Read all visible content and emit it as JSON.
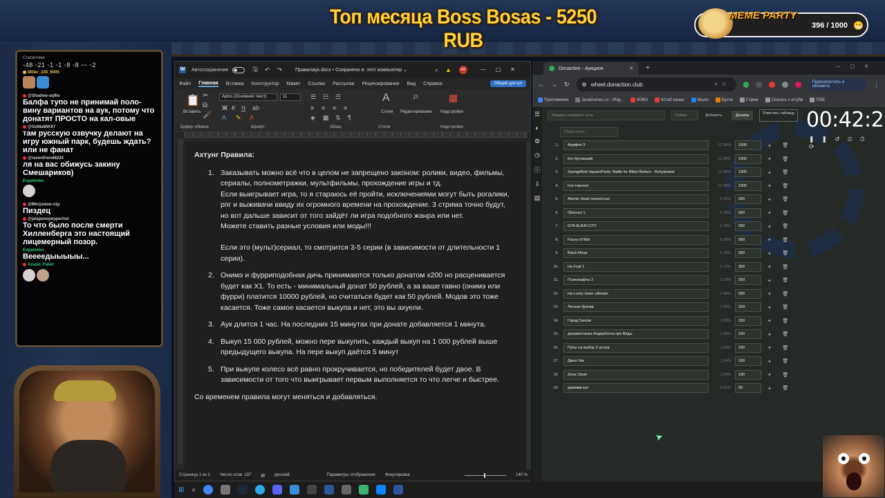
{
  "overlay": {
    "title": "Топ месяца Boss Bosas - 5250 RUB",
    "meme_party": {
      "title": "MEME PARTY",
      "counter": "396 / 1000"
    }
  },
  "chat": {
    "stats_title": "Статистика",
    "stats_line": "◦48 ◦21 ◦1 ◦1 ◦8 ◦8 ◦~ ◦2",
    "messages": [
      {
        "user": "Miller_228_6005",
        "text": "",
        "color": "#e6c14a"
      },
      {
        "user": "@Shadow-sq9lo",
        "text": "Балфа тупо не принимай поло-вину вариантов на аук, потому что донатят ПРОСТО на кал-овые",
        "color": "#cfcfcf"
      },
      {
        "user": "@GoMaMiK67",
        "text": "там русскую озвучку делают на игру южный парк, будешь ждать? или не фанат",
        "color": "#cfcfcf"
      },
      {
        "user": "@ravenfriend8224",
        "text": "ля на вас обижусь закину Смешариков)",
        "color": "#cfcfcf"
      },
      {
        "user": "Evpatenko",
        "text": "",
        "color": "#2ecc71"
      },
      {
        "user": "@Метрокон-з1р",
        "text": "Пиздец",
        "color": "#cfcfcf"
      },
      {
        "user": "@jalapenopepperhot",
        "text": "То что было после смерти Хилленберга это настоящий лицемерный позор.",
        "color": "#cfcfcf"
      },
      {
        "user": "Evpatenko",
        "text": "Веееедыыыыы...",
        "color": "#2ecc71"
      },
      {
        "user": "Azazel_Falen",
        "text": "",
        "color": "#2ecc71"
      }
    ]
  },
  "word": {
    "autosave_label": "Автосохранение",
    "doc_title": "Правилаук.docx • Сохранено в: этот компьютер ⌄",
    "user_initials": "AS",
    "menu": [
      "Файл",
      "Главная",
      "Вставка",
      "Конструктор",
      "Макет",
      "Ссылки",
      "Рассылки",
      "Рецензирование",
      "Вид",
      "Справка"
    ],
    "active_menu": "Главная",
    "share_label": "Общий доступ",
    "ribbon": {
      "paste_label": "Вставить",
      "font_name": "Aptos (Основной текст)",
      "font_size": "11",
      "styles_label": "Стили",
      "editing_label": "Редактирование",
      "addins_label": "Надстройки",
      "group_clipboard": "Буфер обмена",
      "group_font": "Шрифт",
      "group_paragraph": "Абзац",
      "group_styles": "Стили",
      "group_addins": "Надстройки"
    },
    "document": {
      "heading": "Ахтунг Правила:",
      "items": [
        {
          "num": "1.",
          "text": "Заказывать можно всё что в целом не запрещено законом: ролики, видео, фильмы, сериалы, полнометражки, мультфильмы, прохождение игры и тд.\nЕсли выигрывает игра, то я стараюсь её пройти, исключениями могут быть рогалики, рпг и выживачи ввиду их огромного времени на прохождение. 3 стрима точно будут, но вот дальше зависит от того зайдёт ли игра подобного жанра или нет.\nМожете ставить разные условия или моды!!!\n\nЕсли это (мульт)сериал, то смотрится 3-5 серии (в зависимости от длительности 1 серии)."
        },
        {
          "num": "2.",
          "text": "Онимэ и фурриподобная дичь принимаются только донатом x200 но расценивается будет как X1. То есть - минимальный донат 50 рублей, а за ваше гавно (онимэ или фурри) платится 10000 рублей, но считаться будет как 50 рублей. Модов это тоже касается. Тоже самое касается выкупа и нет, это вы ахуели."
        },
        {
          "num": "3.",
          "text": "Аук длится 1 час. На последних 15 минутах при донате добавляется 1 минута."
        },
        {
          "num": "4.",
          "text": "Выкуп 15 000 рублей, можно пере выкупить, каждый выкуп на 1 000 рублей выше предыдущего выкупа. На пере выкуп даётся 5 минут"
        },
        {
          "num": "5.",
          "text": "При выкупе колесо всё равно прокручивается, но победителей будет двое. В зависимости от того что выигрывает первым выполняется то что легче и быстрее."
        }
      ],
      "footer": "Со временем правила могут меняться и добавляться."
    },
    "status": {
      "page": "Страница 1 из 1",
      "words": "Число слов: 197",
      "language": "русский",
      "display_settings": "Параметры отображения",
      "focus": "Фокусировка",
      "zoom": "140 %"
    }
  },
  "chrome": {
    "tab_title": "Donaction - Аукцион",
    "url": "wheel.donaction.club",
    "relaunch_label": "Перезапустить и обновить",
    "bookmarks": [
      "Приложения",
      "JavaGames.cc - Play...",
      "ВЭКА",
      "Ютаб канал",
      "Мыло",
      "Бусти",
      "Стрим",
      "Скачать с ютуба",
      "ПОЕ"
    ],
    "auction": {
      "name_placeholder": "Введите название лота",
      "amount_placeholder": "Сумма",
      "add_label": "Добавить",
      "donates_label": "Донаты",
      "clear_label": "Очистить таблицу",
      "search_placeholder": "Поиск лота...",
      "timer": "00:42:21",
      "lots": [
        {
          "idx": "1.",
          "name": "Фурфел 3",
          "pct": "12.38%",
          "amount": "1000"
        },
        {
          "idx": "2.",
          "name": "Кот Бутовский",
          "pct": "12.38%",
          "amount": "1000"
        },
        {
          "idx": "3.",
          "name": "SpongeBob SquarePants: Battle for Bikini Bottom - Rehydrated",
          "pct": "12.38%",
          "amount": "1000"
        },
        {
          "idx": "4.",
          "name": "Iron Harvest",
          "pct": "12.38%",
          "amount": "1000"
        },
        {
          "idx": "5.",
          "name": "Atomic Heart полностью",
          "pct": "6.20%",
          "amount": "500"
        },
        {
          "idx": "6.",
          "name": "Obscure 1",
          "pct": "6.20%",
          "amount": "500"
        },
        {
          "idx": "7.",
          "name": "GTA ALIEN CITY",
          "pct": "6.20%",
          "amount": "500"
        },
        {
          "idx": "8.",
          "name": "Faces of War",
          "pct": "6.20%",
          "amount": "500"
        },
        {
          "idx": "9.",
          "name": "Black Mesa",
          "pct": "6.20%",
          "amount": "500"
        },
        {
          "idx": "10.",
          "name": "Ha Fnaf 1",
          "pct": "3.72%",
          "amount": "300"
        },
        {
          "idx": "11.",
          "name": "Психонафты 2",
          "pct": "3.10%",
          "amount": "250"
        },
        {
          "idx": "12.",
          "name": "На Lucky tower ultimate",
          "pct": "2.48%",
          "amount": "200"
        },
        {
          "idx": "13.",
          "name": "Лесная братва",
          "pct": "2.09%",
          "amount": "169"
        },
        {
          "idx": "14.",
          "name": "Город Грехов",
          "pct": "1.86%",
          "amount": "150"
        },
        {
          "idx": "15.",
          "name": "документалка Андербогла про Веды",
          "pct": "1.86%",
          "amount": "150"
        },
        {
          "idx": "16.",
          "name": "Пупы на выбор 2 штука",
          "pct": "1.24%",
          "amount": "100"
        },
        {
          "idx": "17.",
          "name": "Джон Уик",
          "pct": "1.24%",
          "amount": "100"
        },
        {
          "idx": "18.",
          "name": "Zena Clash",
          "pct": "1.24%",
          "amount": "100"
        },
        {
          "idx": "19.",
          "name": "джимми куп",
          "pct": "0.62%",
          "amount": "50"
        }
      ]
    }
  }
}
